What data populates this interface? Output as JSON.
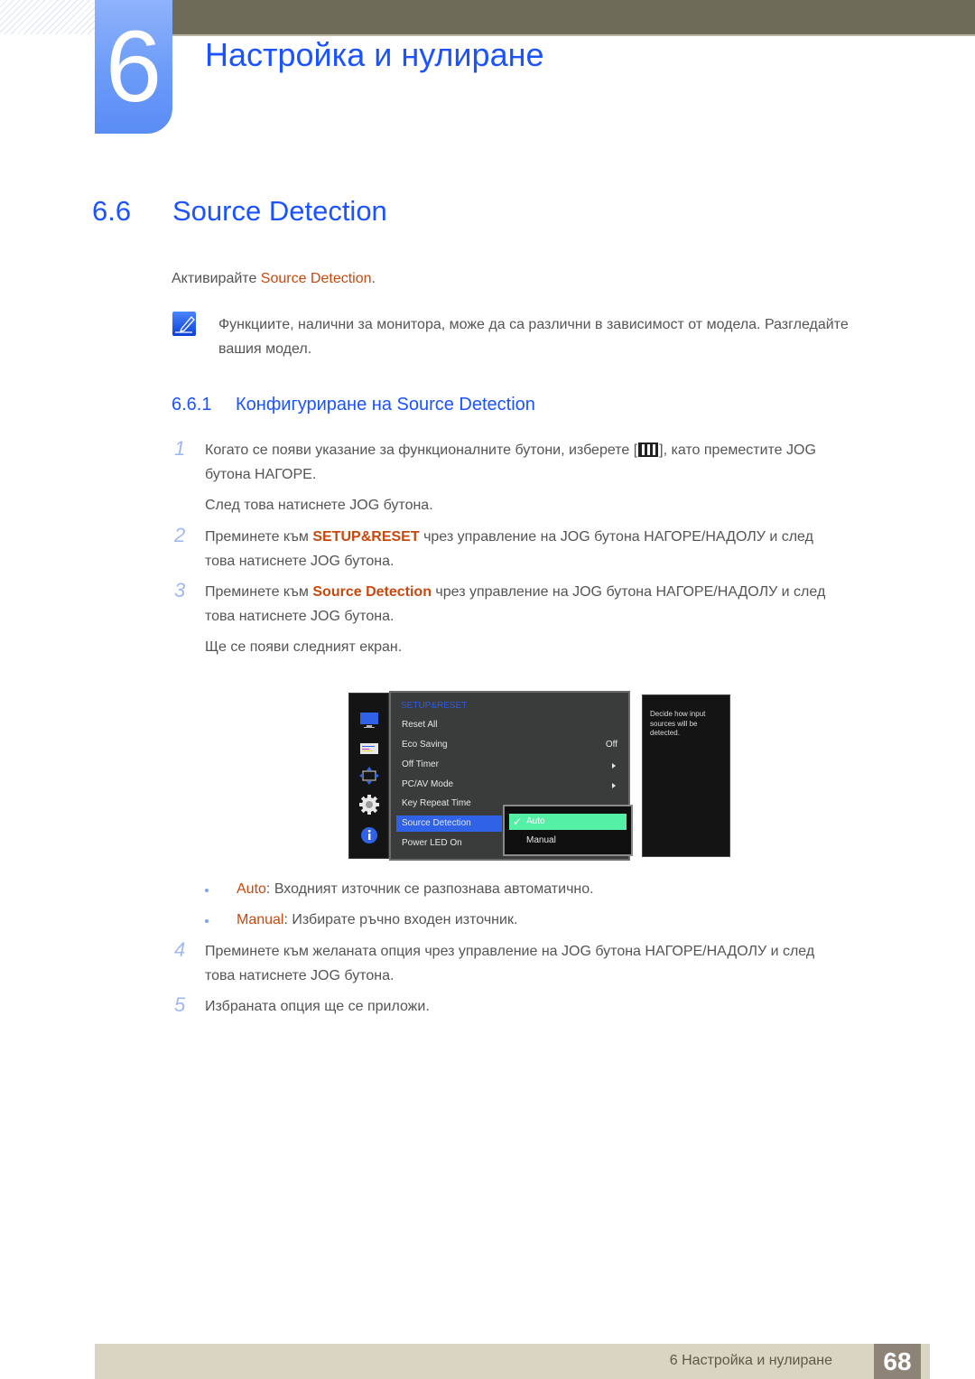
{
  "header": {
    "chapter_number": "6",
    "chapter_title": "Настройка и нулиране"
  },
  "section": {
    "number": "6.6",
    "title": "Source Detection",
    "intro_prefix": "Активирайте ",
    "intro_highlight": "Source Detection",
    "intro_suffix": ".",
    "note_icon": "note-pencil-icon",
    "note_line1": "Функциите, налични за монитора, може да са различни в зависимост от модела. Разгледайте",
    "note_line2": "вашия модел."
  },
  "subsection": {
    "number": "6.6.1",
    "title": "Конфигуриране на Source Detection"
  },
  "steps": [
    {
      "num": "1",
      "line1_prefix": "Когато се появи указание за функционалните бутони, изберете [",
      "line1_icon": "menu-grid-icon",
      "line1_suffix": "], като преместите JOG",
      "line2": "бутона НАГОРЕ.",
      "extra": "След това натиснете JOG бутона."
    },
    {
      "num": "2",
      "prefix": "Преминете към ",
      "highlight": "SETUP&RESET",
      "suffix": " чрез управление на JOG бутона НАГОРЕ/НАДОЛУ и след",
      "line2": "това натиснете JOG бутона."
    },
    {
      "num": "3",
      "prefix": "Преминете към ",
      "highlight": "Source Detection",
      "suffix": " чрез управление на JOG бутона НАГОРЕ/НАДОЛУ и след",
      "line2": "това натиснете JOG бутона.",
      "extra": "Ще се появи следният екран."
    },
    {
      "num": "4",
      "line1": "Преминете към желаната опция чрез управление на JOG бутона НАГОРЕ/НАДОЛУ и след",
      "line2": "това натиснете JOG бутона."
    },
    {
      "num": "5",
      "line1": "Избраната опция ще се приложи."
    }
  ],
  "osd": {
    "side_icons": [
      "monitor-icon",
      "picture-settings-icon",
      "position-arrows-icon",
      "gear-icon",
      "info-icon"
    ],
    "menu_title": "SETUP&RESET",
    "items": [
      {
        "label": "Reset All",
        "value": ""
      },
      {
        "label": "Eco Saving",
        "value": "Off"
      },
      {
        "label": "Off Timer",
        "value": "▸"
      },
      {
        "label": "PC/AV Mode",
        "value": "▸"
      },
      {
        "label": "Key Repeat Time",
        "value": ""
      },
      {
        "label": "Source Detection",
        "value": "",
        "selected": true
      },
      {
        "label": "Power LED On",
        "value": ""
      }
    ],
    "popup_options": [
      {
        "label": "Auto",
        "selected": true
      },
      {
        "label": "Manual",
        "selected": false
      }
    ],
    "help_text": "Decide how input sources will be detected.",
    "colors": {
      "title": "#2c59e8",
      "selected_item": "#2f62e6",
      "selected_option": "#53f0a6"
    }
  },
  "options_explained": [
    {
      "name": "Auto",
      "text": ": Входният източник се разпознава автоматично."
    },
    {
      "name": "Manual",
      "text": ": Избирате ръчно входен източник."
    }
  ],
  "footer": {
    "chapter_label": "6 Настройка и нулиране",
    "page_number": "68"
  },
  "colors": {
    "heading_blue": "#1a53ff",
    "accent_orange": "#c9480e",
    "top_bar": "#6d6c59",
    "footer_band": "#dad5c3",
    "page_badge": "#8e8377"
  }
}
